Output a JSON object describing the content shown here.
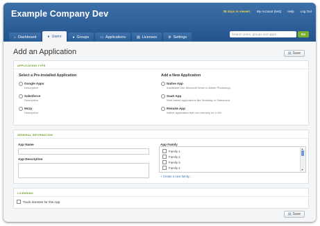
{
  "header": {
    "app_title": "Example Company Dev",
    "trial_notice": "38 days in viewer!",
    "links": [
      "My Account (test)",
      "Help",
      "Log Out"
    ]
  },
  "nav": {
    "tabs": [
      {
        "label": "Dashboard",
        "icon": "home-icon",
        "active": false
      },
      {
        "label": "Users",
        "icon": "users-icon",
        "active": true
      },
      {
        "label": "Groups",
        "icon": "groups-icon",
        "active": false
      },
      {
        "label": "Applications",
        "icon": "applications-icon",
        "active": false
      },
      {
        "label": "Licenses",
        "icon": "licenses-icon",
        "active": false
      },
      {
        "label": "Settings",
        "icon": "gear-icon",
        "active": false
      }
    ],
    "search_placeholder": "Search users, groups and apps...",
    "go_label": "Go"
  },
  "page": {
    "title": "Add an Application",
    "save_label": "Save"
  },
  "application_type": {
    "section_label": "APPLICATION TYPE",
    "preinstalled_heading": "Select a Pre-installed Application",
    "new_heading": "Add a New Application",
    "preinstalled": [
      {
        "name": "Google Apps",
        "desc": "Description"
      },
      {
        "name": "Salesforce",
        "desc": "Description"
      },
      {
        "name": "Mozy",
        "desc": "Description"
      }
    ],
    "new_apps": [
      {
        "name": "Native App",
        "desc": "Installable Like Microsoft Word or Adobe Photoshop."
      },
      {
        "name": "SaaS App",
        "desc": "Web-based applications like Workday or Salesforce."
      },
      {
        "name": "Remote App",
        "desc": "Native application that run remotely on a VM."
      }
    ]
  },
  "general_info": {
    "section_label": "GENERAL INFORMATION",
    "app_name_label": "App Name",
    "app_name_value": "",
    "app_desc_label": "App Description",
    "app_desc_value": "",
    "family_label": "App Family",
    "families": [
      "Family 1",
      "Family 2",
      "Family 3",
      "Family 4"
    ],
    "create_family_link": "+ Create a new family..."
  },
  "licensing": {
    "section_label": "LICENSING",
    "track_label": "Track licenses for this App"
  },
  "colors": {
    "header": "#2b5d96",
    "accent_green": "#7ab12d",
    "trial_yellow": "#f0d34b",
    "link_blue": "#3b6fae"
  }
}
